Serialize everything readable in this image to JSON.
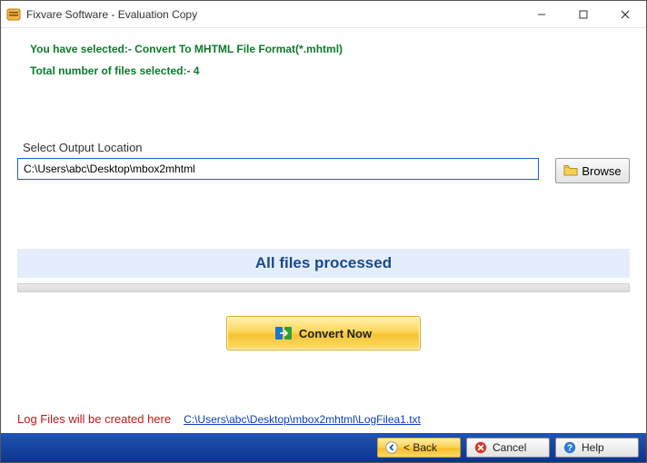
{
  "window": {
    "title": "Fixvare Software - Evaluation Copy"
  },
  "info": {
    "selected_line": "You have selected:- Convert To MHTML File Format(*.mhtml)",
    "count_line": "Total number of files selected:- 4"
  },
  "output": {
    "label": "Select Output Location",
    "path": "C:\\Users\\abc\\Desktop\\mbox2mhtml",
    "browse_label": "Browse"
  },
  "status": {
    "text": "All files processed"
  },
  "convert": {
    "label": "Convert Now"
  },
  "log": {
    "label": "Log Files will be created here",
    "link": "C:\\Users\\abc\\Desktop\\mbox2mhtml\\LogFilea1.txt"
  },
  "footer": {
    "back": "< Back",
    "cancel": "Cancel",
    "help": "Help"
  }
}
